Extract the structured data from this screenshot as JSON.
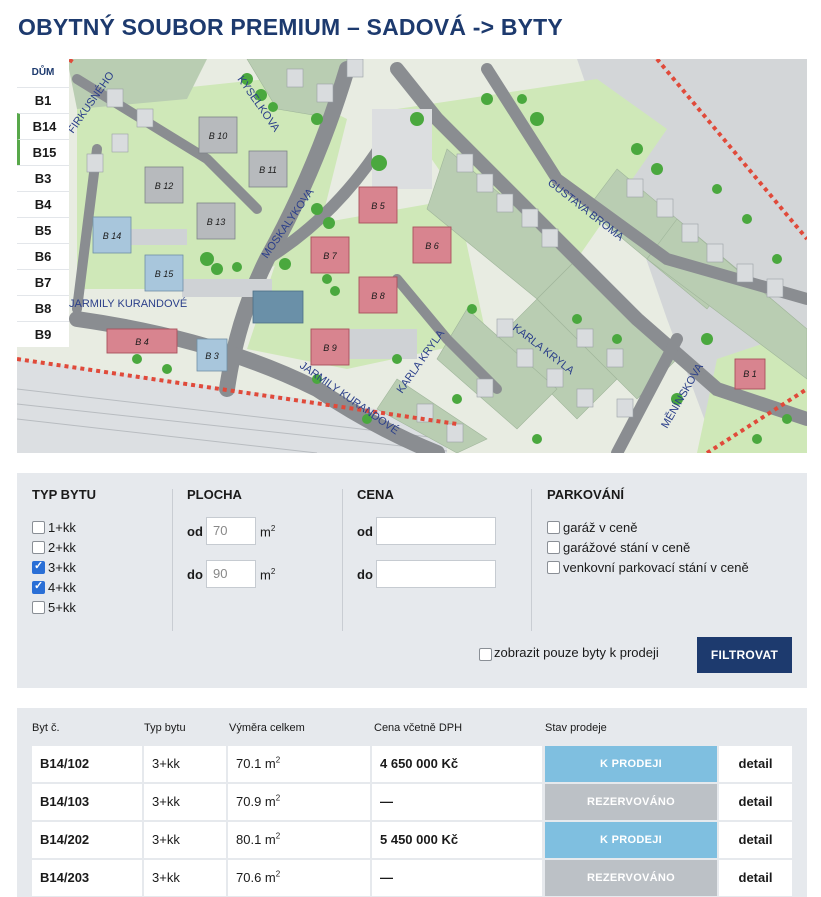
{
  "page": {
    "title": "OBYTNÝ SOUBOR PREMIUM – SADOVÁ -> BYTY"
  },
  "map": {
    "house_list_header": "DŮM",
    "houses": [
      "B1",
      "B14",
      "B15",
      "B3",
      "B4",
      "B5",
      "B6",
      "B7",
      "B8",
      "B9"
    ],
    "buildings": [
      "B 10",
      "B 11",
      "B 12",
      "B 13",
      "B 14",
      "B 15",
      "B 5",
      "B 6",
      "B 7",
      "B 8",
      "B 9",
      "B 4",
      "B 3",
      "B 1"
    ],
    "streets": [
      "KYSELKOVA",
      "MOSKALYKOVA",
      "GUSTAVA BROMA",
      "KARLA KRYLA",
      "KARLA KRYLA",
      "JARMILY KURANDOVÉ",
      "JARMILY KURANDOVÉ",
      "MĚNÍNSKOVA",
      "FIRKUSNÉHO"
    ],
    "colors": {
      "roads": "#8a8d91",
      "green": "#cfe8b8",
      "plots": "#b9cdb2",
      "highlight": "#d96a78",
      "highlight_roof": "#d8848f",
      "blue_roof": "#a8c6dc",
      "border_red": "#e04a3a"
    }
  },
  "filter": {
    "type": {
      "heading": "TYP BYTU",
      "options": [
        {
          "label": "1+kk",
          "checked": false
        },
        {
          "label": "2+kk",
          "checked": false
        },
        {
          "label": "3+kk",
          "checked": true
        },
        {
          "label": "4+kk",
          "checked": true
        },
        {
          "label": "5+kk",
          "checked": false
        }
      ]
    },
    "area": {
      "heading": "PLOCHA",
      "from_label": "od",
      "from_value": "70",
      "to_label": "do",
      "to_value": "90",
      "unit": "m",
      "unit_exp": "2"
    },
    "price": {
      "heading": "CENA",
      "from_label": "od",
      "from_value": "",
      "to_label": "do",
      "to_value": ""
    },
    "parking": {
      "heading": "PARKOVÁNÍ",
      "options": [
        {
          "label": "garáž v ceně",
          "checked": false
        },
        {
          "label": "garážové stání v ceně",
          "checked": false
        },
        {
          "label": "venkovní parkovací stání v ceně",
          "checked": false
        }
      ]
    },
    "only_for_sale": {
      "label": "zobrazit pouze byty k prodeji",
      "checked": false
    },
    "submit_label": "FILTROVAT",
    "colors": {
      "panel": "#e6e9ed",
      "button": "#1d3a6e",
      "checkbox_on": "#2a6fd6"
    }
  },
  "table": {
    "headers": [
      "Byt č.",
      "Typ bytu",
      "Výměra celkem",
      "Cena včetně DPH",
      "Stav prodeje"
    ],
    "rows": [
      {
        "id": "B14/102",
        "type": "3+kk",
        "area": "70.1 m",
        "area_exp": "2",
        "price": "4 650 000 Kč",
        "status": "K PRODEJI",
        "status_kind": "sale",
        "detail": "detail"
      },
      {
        "id": "B14/103",
        "type": "3+kk",
        "area": "70.9 m",
        "area_exp": "2",
        "price": "—",
        "status": "REZERVOVÁNO",
        "status_kind": "reserved",
        "detail": "detail"
      },
      {
        "id": "B14/202",
        "type": "3+kk",
        "area": "80.1 m",
        "area_exp": "2",
        "price": "5 450 000 Kč",
        "status": "K PRODEJI",
        "status_kind": "sale",
        "detail": "detail"
      },
      {
        "id": "B14/203",
        "type": "3+kk",
        "area": "70.6 m",
        "area_exp": "2",
        "price": "—",
        "status": "REZERVOVÁNO",
        "status_kind": "reserved",
        "detail": "detail"
      }
    ],
    "colors": {
      "sale": "#7fbfe0",
      "reserved": "#bcc1c6"
    }
  }
}
